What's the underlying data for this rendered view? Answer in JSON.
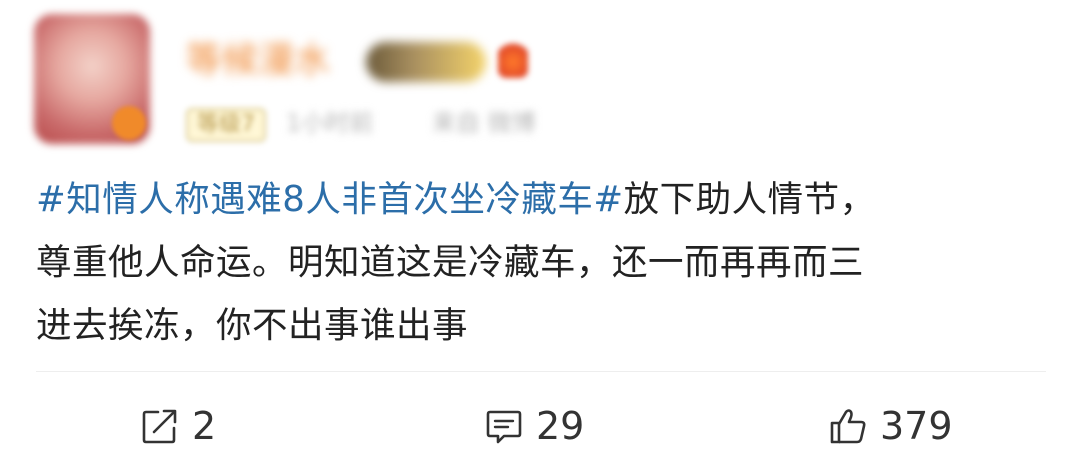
{
  "header": {
    "username": "等候漫水",
    "level": "等级7",
    "time": "1小时前",
    "source": "来自 微博"
  },
  "post": {
    "hashtag": "#知情人称遇难8人非首次坐冷藏车#",
    "text_line1": "放下助人情节，",
    "text_line2": "尊重他人命运。明知道这是冷藏车，还一而再再而三",
    "text_line3": "进去挨冻，你不出事谁出事"
  },
  "actions": {
    "share_count": "2",
    "comment_count": "29",
    "like_count": "379"
  },
  "icons": {
    "share": "share-icon",
    "comment": "comment-icon",
    "like": "like-icon"
  },
  "colors": {
    "hashtag": "#2c6ea9",
    "text": "#222222",
    "username": "#f08c3a"
  }
}
